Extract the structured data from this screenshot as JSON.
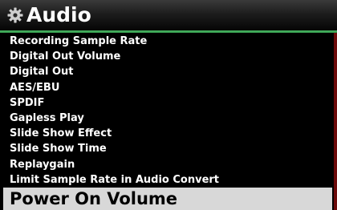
{
  "header": {
    "title": "Audio",
    "icon": "gear-icon"
  },
  "menu": {
    "items": [
      {
        "label": "Recording Sample Rate"
      },
      {
        "label": "Digital Out Volume"
      },
      {
        "label": "Digital Out"
      },
      {
        "label": "AES/EBU"
      },
      {
        "label": "SPDIF"
      },
      {
        "label": "Gapless Play"
      },
      {
        "label": "Slide Show Effect"
      },
      {
        "label": "Slide Show Time"
      },
      {
        "label": "Replaygain"
      },
      {
        "label": "Limit Sample Rate in Audio Convert"
      }
    ],
    "selected": {
      "label": "Power On Volume"
    }
  },
  "colors": {
    "background": "#000000",
    "accent": "#4fc26a",
    "selected_bg": "#d8d8d8",
    "text": "#ffffff"
  }
}
